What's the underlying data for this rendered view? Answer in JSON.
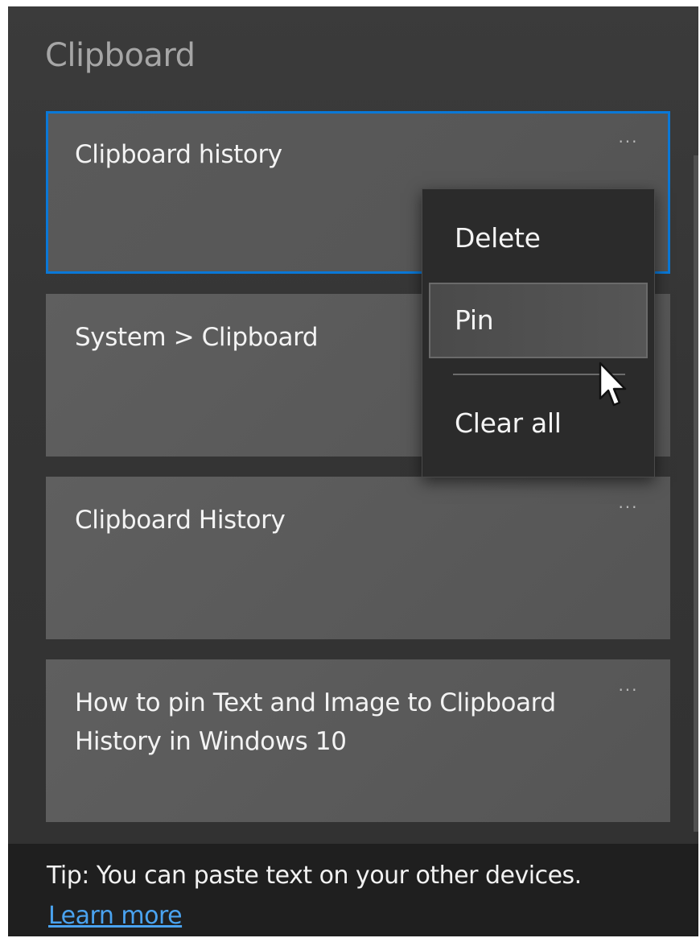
{
  "panel": {
    "title": "Clipboard"
  },
  "items": [
    {
      "text": "Clipboard history",
      "more": "···",
      "selected": true
    },
    {
      "text": "System > Clipboard",
      "more": "···",
      "selected": false
    },
    {
      "text": "Clipboard History",
      "more": "···",
      "selected": false
    },
    {
      "text": "How to pin Text and Image to Clipboard History in Windows 10",
      "more": "···",
      "selected": false
    }
  ],
  "context_menu": {
    "items": [
      {
        "label": "Delete"
      },
      {
        "label": "Pin",
        "hovered": true
      },
      {
        "label": "Clear all"
      }
    ]
  },
  "tip": {
    "text": "Tip: You can paste text on your other devices.",
    "link": "Learn more"
  },
  "colors": {
    "panel_bg": "#353535",
    "item_bg": "#5a5a5a",
    "selection_border": "#0a78d7",
    "menu_bg": "#2b2b2b",
    "tip_bg": "#1f1f1f",
    "link": "#4aa3f0"
  },
  "icons": {
    "more": "more-options-icon",
    "cursor": "mouse-pointer-icon"
  }
}
